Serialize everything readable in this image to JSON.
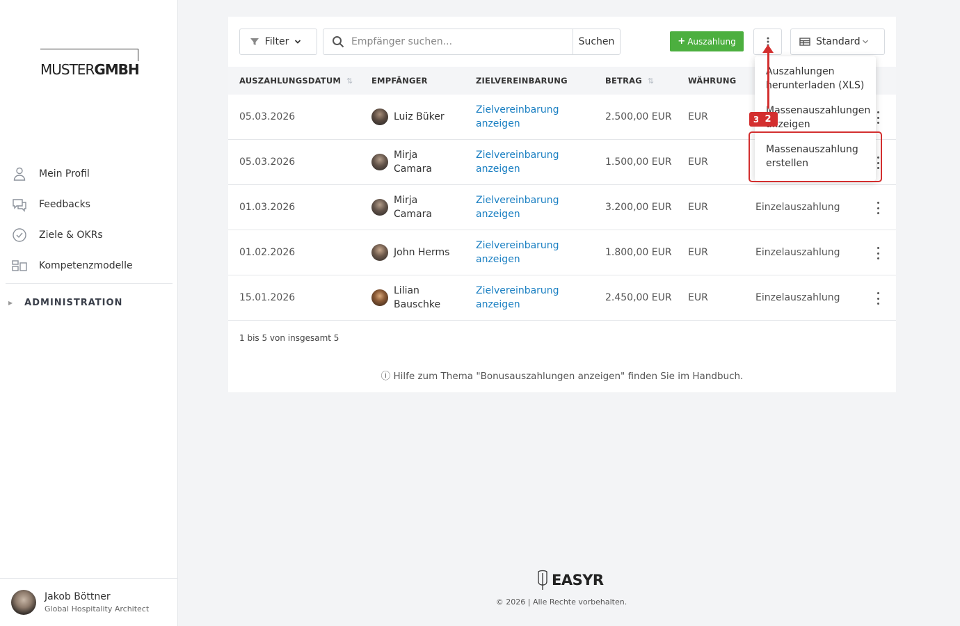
{
  "sidebar": {
    "logo_thin": "MUSTER",
    "logo_bold": "GMBH",
    "items": [
      {
        "label": "Mein Profil",
        "icon": "user-icon"
      },
      {
        "label": "Feedbacks",
        "icon": "chat-icon"
      },
      {
        "label": "Ziele & OKRs",
        "icon": "check-circle-icon"
      },
      {
        "label": "Kompetenzmodelle",
        "icon": "grid-icon"
      }
    ],
    "admin_label": "ADMINISTRATION",
    "user": {
      "name": "Jakob Böttner",
      "role": "Global Hospitality Architect"
    }
  },
  "toolbar": {
    "filter_label": "Filter",
    "search_placeholder": "Empfänger suchen...",
    "search_button": "Suchen",
    "add_label": "Auszahlung",
    "view_label": "Standard"
  },
  "table": {
    "columns": [
      "AUSZAHLUNGSDATUM",
      "EMPFÄNGER",
      "ZIELVEREINBARUNG",
      "BETRAG",
      "WÄHRUNG"
    ],
    "rows": [
      {
        "date": "05.03.2026",
        "recipient": "Luiz Büker",
        "link": "Zielvereinbarung anzeigen",
        "amount": "2.500,00 EUR",
        "currency": "EUR",
        "type": ""
      },
      {
        "date": "05.03.2026",
        "recipient": "Mirja Camara",
        "link": "Zielvereinbarung anzeigen",
        "amount": "1.500,00 EUR",
        "currency": "EUR",
        "type": ""
      },
      {
        "date": "01.03.2026",
        "recipient": "Mirja Camara",
        "link": "Zielvereinbarung anzeigen",
        "amount": "3.200,00 EUR",
        "currency": "EUR",
        "type": "Einzelauszahlung"
      },
      {
        "date": "01.02.2026",
        "recipient": "John Herms",
        "link": "Zielvereinbarung anzeigen",
        "amount": "1.800,00 EUR",
        "currency": "EUR",
        "type": "Einzelauszahlung"
      },
      {
        "date": "15.01.2026",
        "recipient": "Lilian Bauschke",
        "link": "Zielvereinbarung anzeigen",
        "amount": "2.450,00 EUR",
        "currency": "EUR",
        "type": "Einzelauszahlung"
      }
    ],
    "summary": "1 bis 5 von insgesamt 5",
    "help": "Hilfe zum Thema \"Bonusauszahlungen anzeigen\" finden Sie im Handbuch."
  },
  "dropdown": {
    "items": [
      "Auszahlungen herunterladen (XLS)",
      "Massenauszahlungen anzeigen",
      "Massenauszahlung erstellen"
    ]
  },
  "annotation": {
    "step_behind": "3",
    "step_front": "2"
  },
  "footer": {
    "brand": "EASYR",
    "copyright": "© 2026 | Alle Rechte vorbehalten."
  },
  "colors": {
    "accent_green": "#4caf3f",
    "link_blue": "#1a7fc2",
    "annotation_red": "#d32f2f"
  }
}
